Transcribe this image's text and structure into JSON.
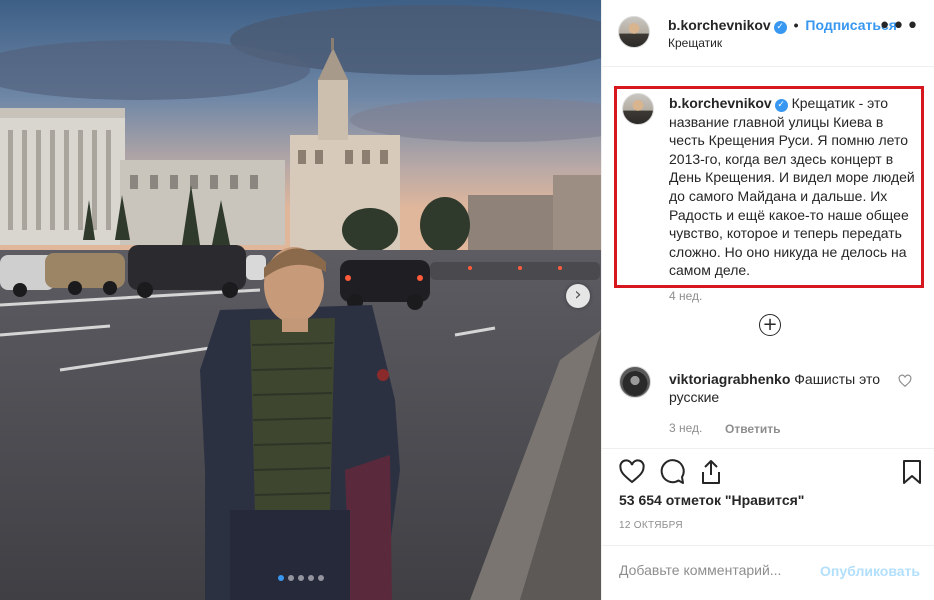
{
  "post": {
    "username": "b.korchevnikov",
    "verified_icon": "verified-badge-icon",
    "separator": "•",
    "follow_label": "Подписаться",
    "location": "Крещатик",
    "more_icon": "more-options-icon",
    "more_glyph": "•••"
  },
  "caption": {
    "username": "b.korchevnikov",
    "text": "Крещатик - это название главной улицы Киева в честь Крещения Руси. Я помню лето 2013-го, когда вел здесь концерт в День Крещения. И видел море людей до самого Майдана и дальше. Их Радость и ещё какое-то наше общее чувство, которое и теперь передать сложно. Но оно никуда не делось на самом деле.",
    "age": "4 нед.",
    "highlight_color": "#d6171d"
  },
  "load_more": {
    "glyph": "+"
  },
  "comments": [
    {
      "username": "viktoriagrabhenko",
      "text": "Фашисты это русские",
      "age": "3 нед.",
      "reply_label": "Ответить"
    }
  ],
  "actions": {
    "like_icon": "heart-icon",
    "comment_icon": "comment-icon",
    "share_icon": "share-icon",
    "save_icon": "bookmark-icon"
  },
  "likes_text": "53 654 отметок \"Нравится\"",
  "date": "12 ОКТЯБРЯ",
  "add_comment": {
    "placeholder": "Добавьте комментарий...",
    "value": "",
    "publish_label": "Опубликовать"
  },
  "carousel": {
    "next_glyph": "›",
    "slide_count": 5,
    "active_index": 0,
    "active_color": "#3897f0"
  },
  "colors": {
    "link_blue": "#3897f0",
    "muted": "#8e8e8e",
    "text": "#262626"
  }
}
